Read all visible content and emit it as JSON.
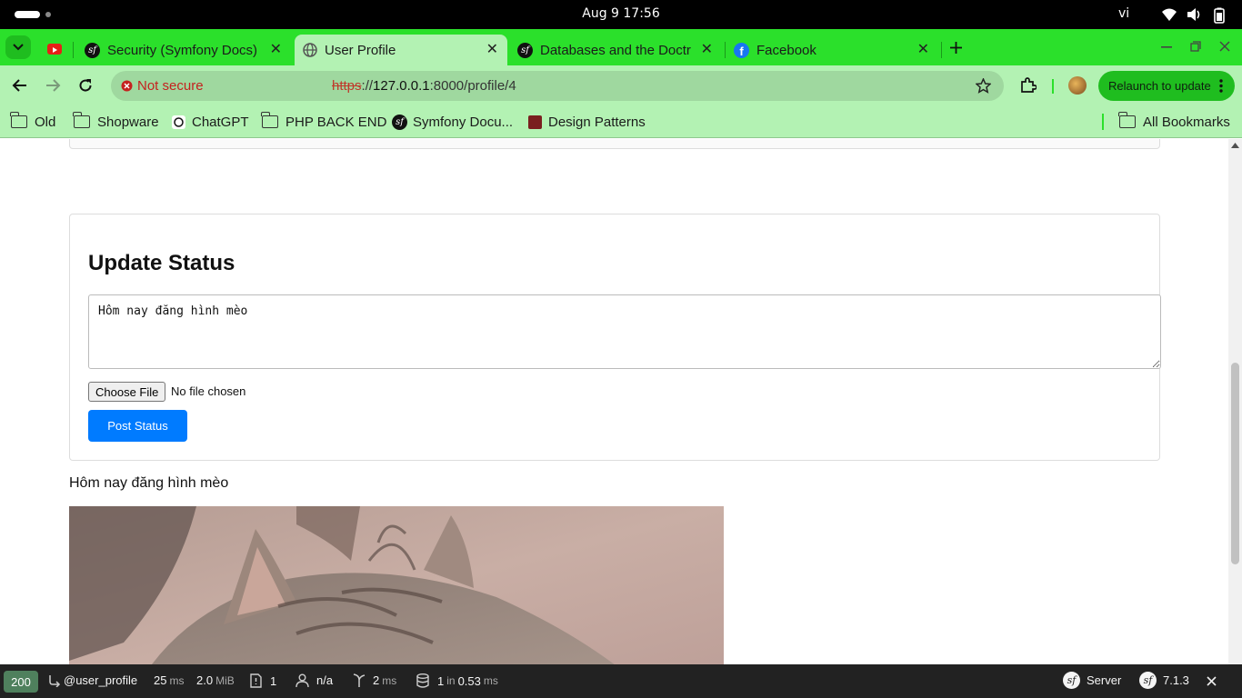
{
  "os": {
    "clock": "Aug 9  17:56",
    "lang": "vi"
  },
  "tabs": [
    {
      "title": "Security (Symfony Docs)",
      "icon": "symfony-icon",
      "active": false
    },
    {
      "title": "User Profile",
      "icon": "globe-icon",
      "active": true
    },
    {
      "title": "Databases and the Doctr",
      "icon": "symfony-icon",
      "active": false
    },
    {
      "title": "Facebook",
      "icon": "facebook-icon",
      "active": false
    }
  ],
  "toolbar": {
    "not_secure": "Not secure",
    "url_scheme": "https",
    "url_sep": "://",
    "url_host": "127.0.0.1",
    "url_rest": ":8000/profile/4",
    "relaunch": "Relaunch to update"
  },
  "bookmarks": [
    {
      "label": "Old",
      "icon": "folder-icon"
    },
    {
      "label": "Shopware",
      "icon": "folder-icon"
    },
    {
      "label": "ChatGPT",
      "icon": "chatgpt-icon"
    },
    {
      "label": "PHP BACK END",
      "icon": "folder-icon"
    },
    {
      "label": "Symfony Docu...",
      "icon": "symfony-icon"
    },
    {
      "label": "Design Patterns",
      "icon": "design-patterns-icon"
    },
    {
      "label": "All Bookmarks",
      "icon": "folder-icon"
    }
  ],
  "page": {
    "status_heading": "Update Status",
    "status_text": "Hôm nay đăng hình mèo",
    "choose_file": "Choose File",
    "no_file": "No file chosen",
    "post_button": "Post Status",
    "post_caption": "Hôm nay đăng hình mèo"
  },
  "profiler": {
    "status_code": "200",
    "route": "@user_profile",
    "time_value": "25",
    "time_unit": "ms",
    "memory_value": "2.0",
    "memory_unit": "MiB",
    "logs_count": "1",
    "user": "n/a",
    "twig_value": "2",
    "twig_unit": "ms",
    "db_queries": "1",
    "db_in": "in",
    "db_time": "0.53",
    "db_unit": "ms",
    "server": "Server",
    "version": "7.1.3"
  },
  "colors": {
    "tabstrip": "#2be02b",
    "toolbar": "#b3f2b3",
    "post_button": "#007bff",
    "profiler_bg": "#222222",
    "status_200": "#4f805d"
  }
}
